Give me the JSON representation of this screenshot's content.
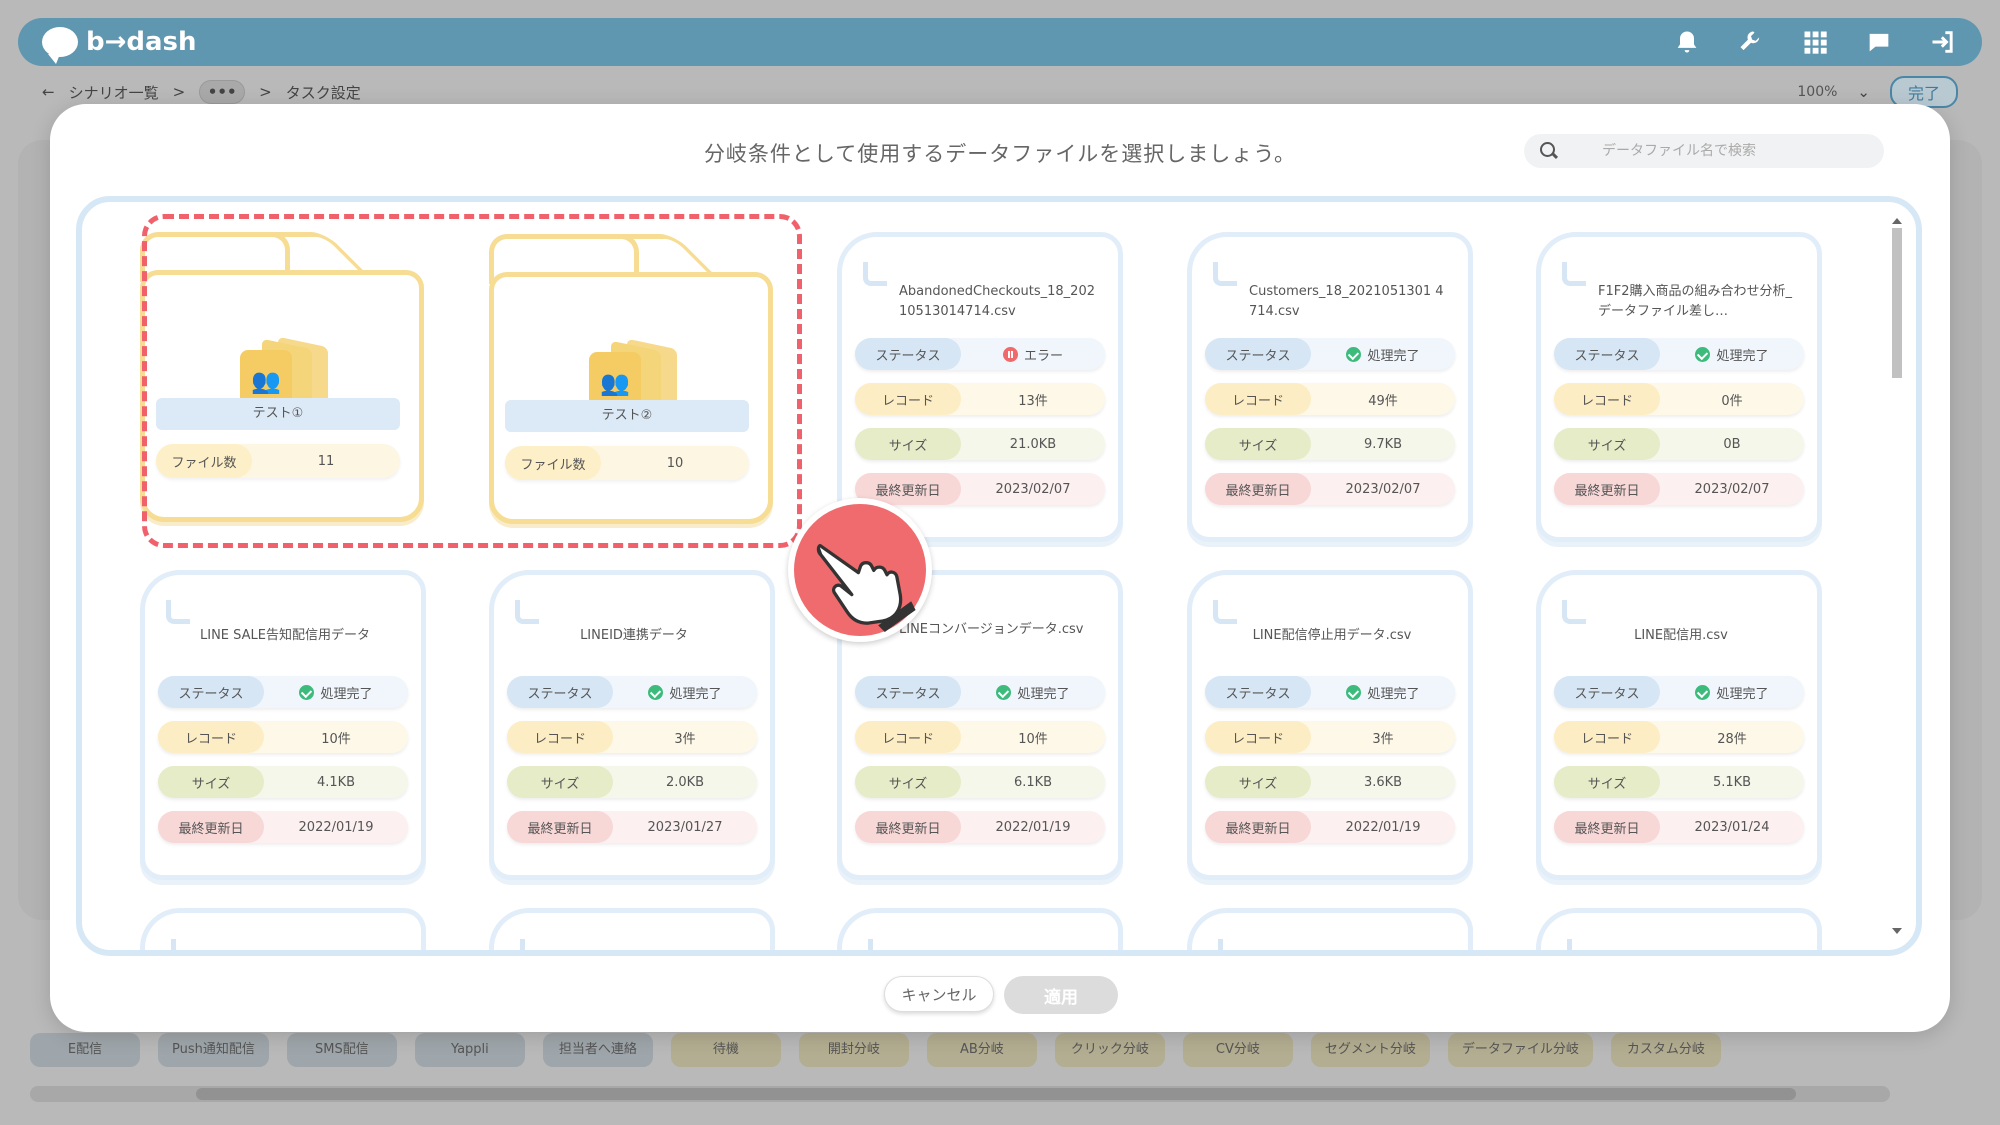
{
  "header": {
    "logo_text": "b→dash",
    "icons": [
      "bell-icon",
      "wrench-icon",
      "grid-icon",
      "chat-icon",
      "logout-icon"
    ]
  },
  "breadcrumb": {
    "back": "←",
    "scenario_list": "シナリオ一覧",
    "sep1": ">",
    "more": "•••",
    "sep2": ">",
    "current": "タスク設定",
    "zoom": "100%",
    "done": "完了"
  },
  "modal": {
    "title": "分岐条件として使用するデータファイルを選択しましょう。",
    "search_placeholder": "データファイル名で検索",
    "cancel_label": "キャンセル",
    "apply_label": "適用"
  },
  "labels": {
    "file_count": "ファイル数",
    "status": "ステータス",
    "record": "レコード",
    "size": "サイズ",
    "updated": "最終更新日"
  },
  "folders": [
    {
      "name": "テスト①",
      "count": "11"
    },
    {
      "name": "テスト②",
      "count": "10"
    }
  ],
  "files": [
    {
      "name": "AbandonedCheckouts_18_20210513014714.csv",
      "status": "エラー",
      "status_type": "error",
      "record": "13件",
      "size": "21.0KB",
      "updated": "2023/02/07"
    },
    {
      "name": "Customers_18_2021051301 4714.csv",
      "status": "処理完了",
      "status_type": "ok",
      "record": "49件",
      "size": "9.7KB",
      "updated": "2023/02/07"
    },
    {
      "name": "F1F2購入商品の組み合わせ分析_データファイル差し…",
      "status": "処理完了",
      "status_type": "ok",
      "record": "0件",
      "size": "0B",
      "updated": "2023/02/07"
    },
    {
      "name": "LINE SALE告知配信用データ",
      "status": "処理完了",
      "status_type": "ok",
      "record": "10件",
      "size": "4.1KB",
      "updated": "2022/01/19"
    },
    {
      "name": "LINEID連携データ",
      "status": "処理完了",
      "status_type": "ok",
      "record": "3件",
      "size": "2.0KB",
      "updated": "2023/01/27"
    },
    {
      "name": "LINEコンバージョンデータ.csv",
      "status": "処理完了",
      "status_type": "ok",
      "record": "10件",
      "size": "6.1KB",
      "updated": "2022/01/19"
    },
    {
      "name": "LINE配信停止用データ.csv",
      "status": "処理完了",
      "status_type": "ok",
      "record": "3件",
      "size": "3.6KB",
      "updated": "2022/01/19"
    },
    {
      "name": "LINE配信用.csv",
      "status": "処理完了",
      "status_type": "ok",
      "record": "28件",
      "size": "5.1KB",
      "updated": "2023/01/24"
    }
  ],
  "bottom_bar": [
    "E配信",
    "Push通知配信",
    "SMS配信",
    "Yappli",
    "担当者へ連絡",
    "待機",
    "開封分岐",
    "AB分岐",
    "クリック分岐",
    "CV分岐",
    "セグメント分岐",
    "データファイル分岐",
    "カスタム分岐"
  ]
}
